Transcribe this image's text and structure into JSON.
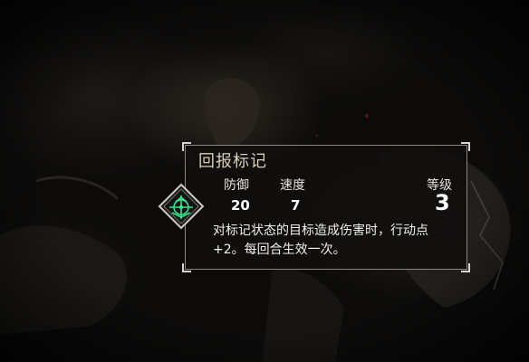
{
  "tooltip": {
    "title": "回报标记",
    "stats": {
      "defense_label": "防御",
      "defense_value": "20",
      "speed_label": "速度",
      "speed_value": "7",
      "level_label": "等级",
      "level_value": "3"
    },
    "description": "对标记状态的目标造成伤害时，行动点+2。每回合生效一次。"
  },
  "emblem": {
    "icon": "target-mark-icon",
    "glow_color": "#3fe08a"
  }
}
